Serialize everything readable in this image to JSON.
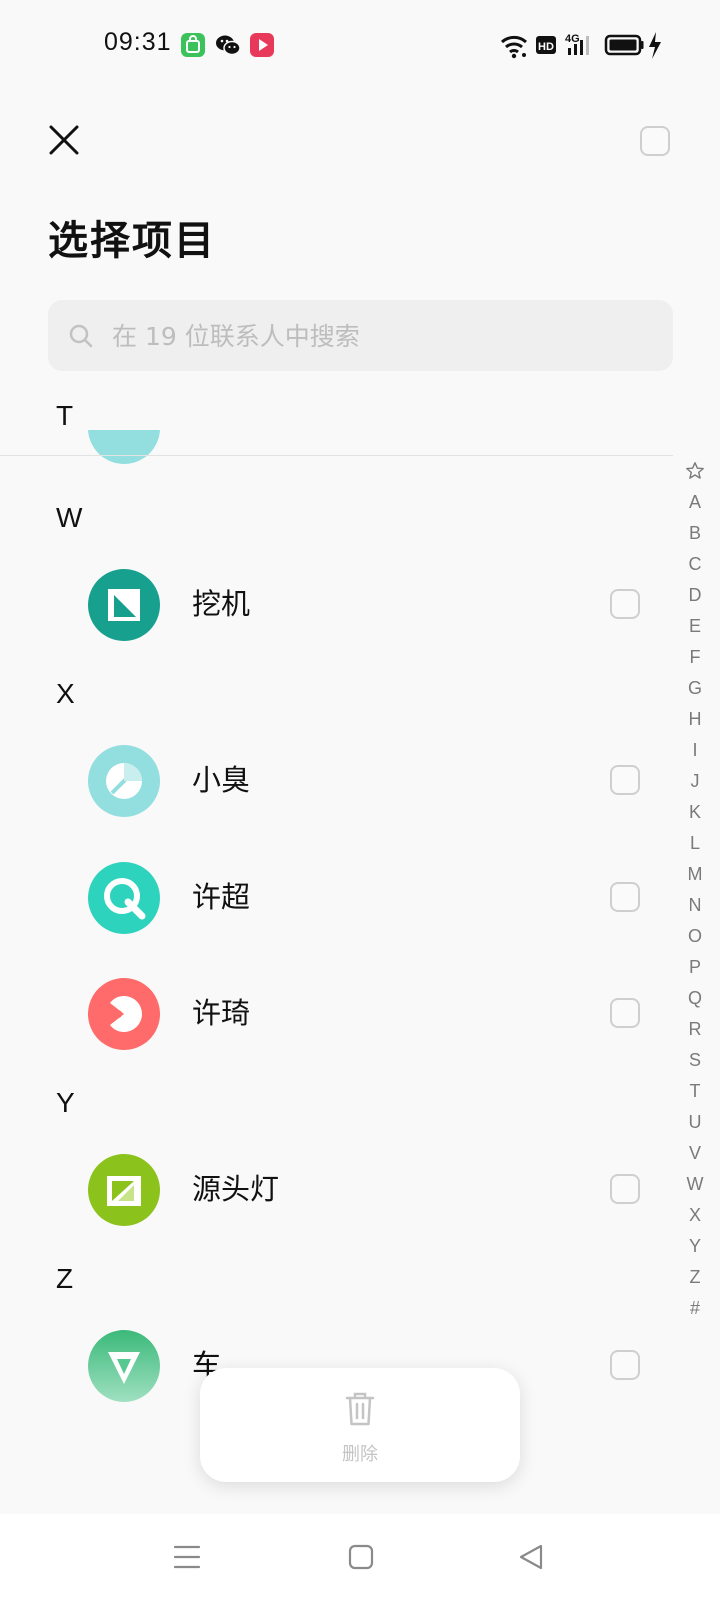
{
  "status_bar": {
    "time": "09:31",
    "app_icons": [
      "app-store-icon",
      "wechat-icon",
      "video-app-icon"
    ],
    "indicators": [
      "wifi-icon",
      "hd-icon",
      "cellular-4g-icon",
      "battery-icon",
      "charging-icon"
    ],
    "hd_label": "HD",
    "network_label": "4G"
  },
  "header": {
    "title": "选择项目",
    "search_placeholder": "在 19 位联系人中搜索"
  },
  "sections": [
    {
      "letter": "T",
      "items": []
    },
    {
      "letter": "W",
      "items": [
        {
          "name": "挖机",
          "avatar_color": "#17a08e"
        }
      ]
    },
    {
      "letter": "X",
      "items": [
        {
          "name": "小臭",
          "avatar_color": "#93dedf"
        },
        {
          "name": "许超",
          "avatar_color": "#2ed3bd"
        },
        {
          "name": "许琦",
          "avatar_color": "#ff6a6a"
        }
      ]
    },
    {
      "letter": "Y",
      "items": [
        {
          "name": "源头灯",
          "avatar_color": "#8cc21c"
        }
      ]
    },
    {
      "letter": "Z",
      "items": [
        {
          "name": "车",
          "avatar_color": "#57c88f"
        }
      ]
    }
  ],
  "alphabet_index": [
    "A",
    "B",
    "C",
    "D",
    "E",
    "F",
    "G",
    "H",
    "I",
    "J",
    "K",
    "L",
    "M",
    "N",
    "O",
    "P",
    "Q",
    "R",
    "S",
    "T",
    "U",
    "V",
    "W",
    "X",
    "Y",
    "Z",
    "#"
  ],
  "delete_panel": {
    "label": "删除"
  },
  "colors": {
    "background": "#f9f9f9",
    "checkbox_border": "#cfcfcf",
    "muted_text": "#bdbdbd"
  }
}
